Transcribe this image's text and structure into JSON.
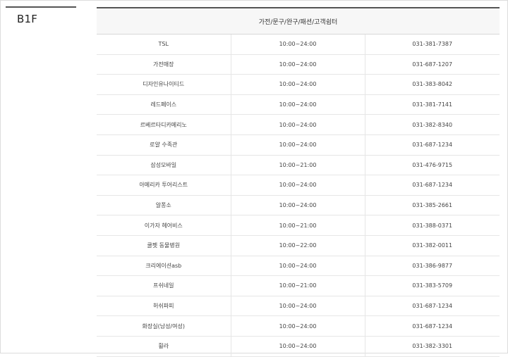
{
  "floor": "B1F",
  "category_header": "가전/문구/완구/패션/고객쉼터",
  "stores": [
    {
      "name": "TSL",
      "hours": "10:00~24:00",
      "phone": "031-381-7387"
    },
    {
      "name": "가전매장",
      "hours": "10:00~24:00",
      "phone": "031-687-1207"
    },
    {
      "name": "디자인유나이티드",
      "hours": "10:00~24:00",
      "phone": "031-383-8042"
    },
    {
      "name": "레드페이스",
      "hours": "10:00~24:00",
      "phone": "031-381-7141"
    },
    {
      "name": "르베르타디카메리노",
      "hours": "10:00~24:00",
      "phone": "031-382-8340"
    },
    {
      "name": "로얄 수족관",
      "hours": "10:00~24:00",
      "phone": "031-687-1234"
    },
    {
      "name": "삼성모바일",
      "hours": "10:00~21:00",
      "phone": "031-476-9715"
    },
    {
      "name": "아메리카 투어리스트",
      "hours": "10:00~24:00",
      "phone": "031-687-1234"
    },
    {
      "name": "알퐁소",
      "hours": "10:00~24:00",
      "phone": "031-385-2661"
    },
    {
      "name": "이가자 헤어비스",
      "hours": "10:00~21:00",
      "phone": "031-388-0371"
    },
    {
      "name": "쿨펫 동물병원",
      "hours": "10:00~22:00",
      "phone": "031-382-0011"
    },
    {
      "name": "크리에이션asb",
      "hours": "10:00~24:00",
      "phone": "031-386-9877"
    },
    {
      "name": "프쉬네일",
      "hours": "10:00~21:00",
      "phone": "031-383-5709"
    },
    {
      "name": "허쉬파피",
      "hours": "10:00~24:00",
      "phone": "031-687-1234"
    },
    {
      "name": "화장실(남성/여성)",
      "hours": "10:00~24:00",
      "phone": "031-687-1234"
    },
    {
      "name": "휠라",
      "hours": "10:00~24:00",
      "phone": "031-382-3301"
    }
  ]
}
